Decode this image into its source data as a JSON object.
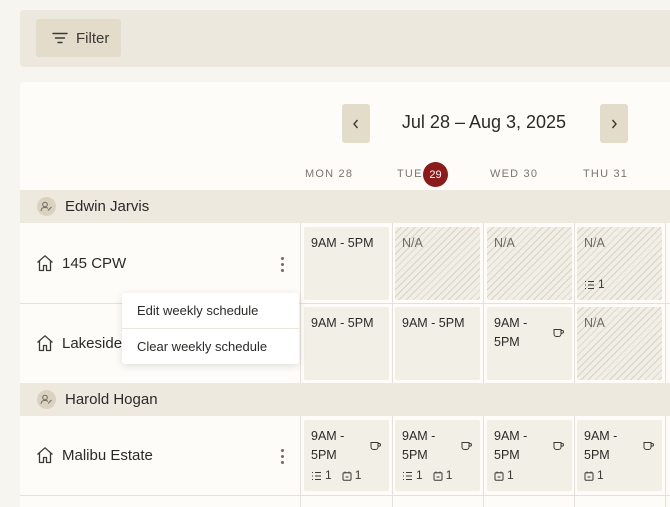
{
  "filter": {
    "label": "Filter"
  },
  "calendar": {
    "range_label": "Jul 28 – Aug 3, 2025",
    "days": [
      {
        "name": "MON 28"
      },
      {
        "name": "TUE",
        "badge": "29"
      },
      {
        "name": "WED 30"
      },
      {
        "name": "THU 31"
      }
    ]
  },
  "groups": [
    {
      "person": "Edwin Jarvis",
      "locations": [
        {
          "name": "145 CPW",
          "cells": [
            {
              "text": "9AM - 5PM",
              "type": "shift"
            },
            {
              "text": "N/A",
              "type": "na"
            },
            {
              "text": "N/A",
              "type": "na"
            },
            {
              "text": "N/A",
              "type": "na",
              "tasks": "1"
            }
          ]
        },
        {
          "name": "Lakeside C",
          "cells": [
            {
              "text": "9AM - 5PM",
              "type": "shift"
            },
            {
              "text": "9AM - 5PM",
              "type": "shift"
            },
            {
              "line1": "9AM -",
              "line2": "5PM",
              "type": "shift",
              "icon": "coffee-icon"
            },
            {
              "text": "N/A",
              "type": "na"
            }
          ]
        }
      ]
    },
    {
      "person": "Harold Hogan",
      "locations": [
        {
          "name": "Malibu Estate",
          "cells": [
            {
              "line1": "9AM -",
              "line2": "5PM",
              "type": "shift",
              "icon": "coffee-icon",
              "tasks": "1",
              "events": "1"
            },
            {
              "line1": "9AM -",
              "line2": "5PM",
              "type": "shift",
              "icon": "coffee-icon",
              "tasks": "1",
              "events": "1"
            },
            {
              "line1": "9AM -",
              "line2": "5PM",
              "type": "shift",
              "icon": "coffee-icon",
              "events": "1"
            },
            {
              "line1": "9AM -",
              "line2": "5PM",
              "type": "shift",
              "icon": "coffee-icon",
              "events": "1"
            }
          ]
        }
      ]
    }
  ],
  "context_menu": {
    "items": [
      "Edit weekly schedule",
      "Clear weekly schedule"
    ]
  },
  "colors": {
    "accent": "#8b1a1a",
    "button_bg": "#e3dccb",
    "group_bg": "#ede9de"
  }
}
